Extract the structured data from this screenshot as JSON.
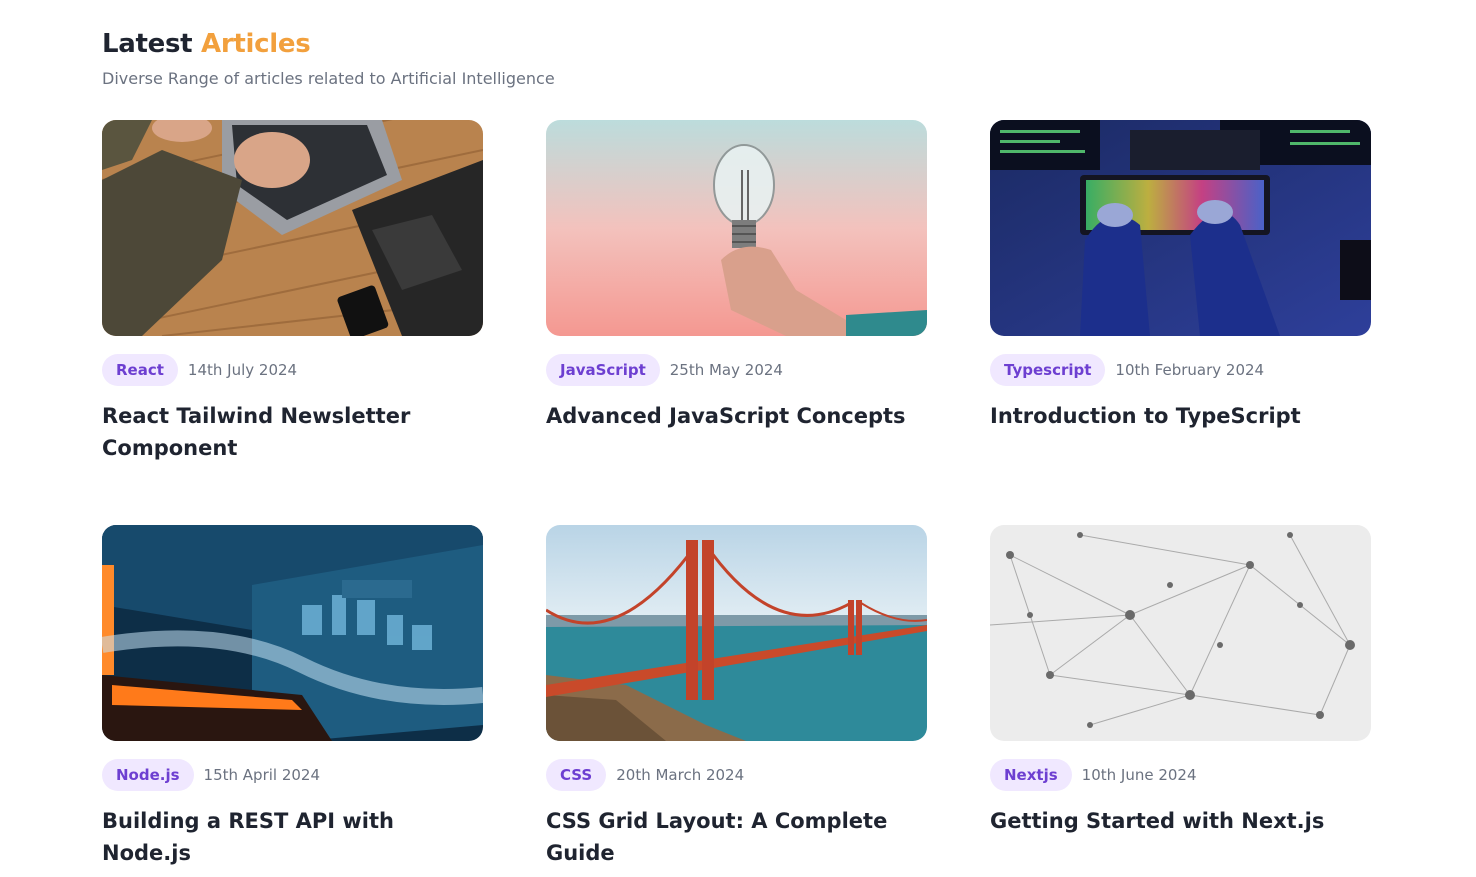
{
  "header": {
    "title_main": "Latest",
    "title_accent": "Articles",
    "subtitle": "Diverse Range of articles related to Artificial Intelligence"
  },
  "colors": {
    "accent": "#f2a03d",
    "tag_bg": "#f0e8ff",
    "tag_text": "#6d3fd1"
  },
  "articles": [
    {
      "tag": "React",
      "date": "14th July 2024",
      "title": "React Tailwind Newsletter Component",
      "image": "laptop-typing-photo"
    },
    {
      "tag": "JavaScript",
      "date": "25th May 2024",
      "title": "Advanced JavaScript Concepts",
      "image": "lightbulb-photo"
    },
    {
      "tag": "Typescript",
      "date": "10th February 2024",
      "title": "Introduction to TypeScript",
      "image": "rgb-keyboard-photo"
    },
    {
      "tag": "Node.js",
      "date": "15th April 2024",
      "title": "Building a REST API with Node.js",
      "image": "motherboard-photo"
    },
    {
      "tag": "CSS",
      "date": "20th March 2024",
      "title": "CSS Grid Layout: A Complete Guide",
      "image": "golden-gate-bridge-photo"
    },
    {
      "tag": "Nextjs",
      "date": "10th June 2024",
      "title": "Getting Started with Next.js",
      "image": "network-nodes-photo"
    }
  ]
}
